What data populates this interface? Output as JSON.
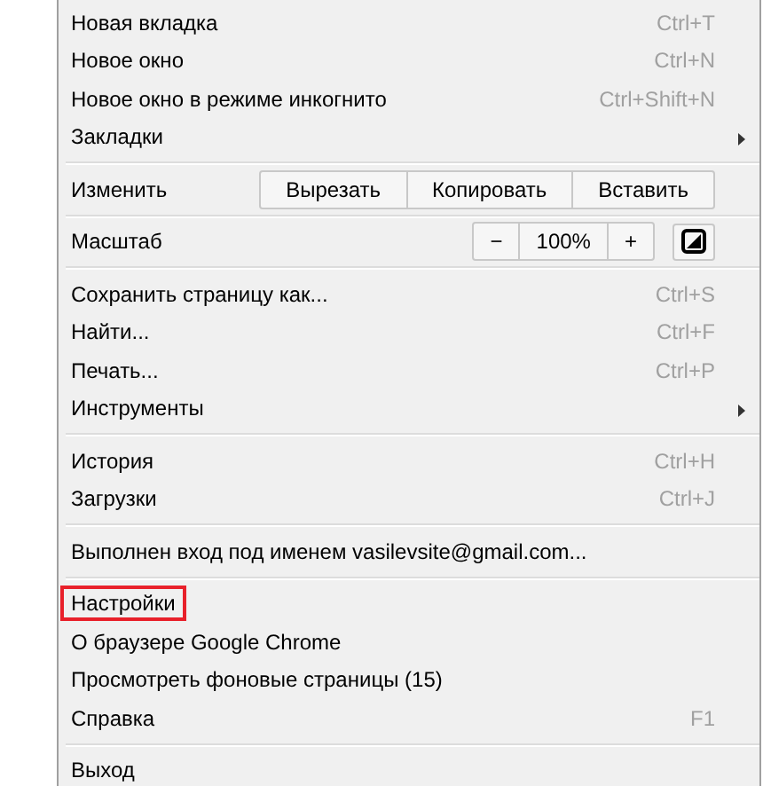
{
  "menu_sections": [
    {
      "items": [
        {
          "kind": "item",
          "label": "Новая вкладка",
          "shortcut": "Ctrl+T"
        },
        {
          "kind": "item",
          "label": "Новое окно",
          "shortcut": "Ctrl+N"
        },
        {
          "kind": "item",
          "label": "Новое окно в режиме инкогнито",
          "shortcut": "Ctrl+Shift+N"
        },
        {
          "kind": "submenu",
          "label": "Закладки"
        }
      ]
    },
    {
      "items": [
        {
          "kind": "edit",
          "label": "Изменить",
          "buttons": [
            "Вырезать",
            "Копировать",
            "Вставить"
          ]
        }
      ]
    },
    {
      "items": [
        {
          "kind": "zoom",
          "label": "Масштаб",
          "minus": "−",
          "value": "100%",
          "plus": "+"
        }
      ]
    },
    {
      "items": [
        {
          "kind": "item",
          "label": "Сохранить страницу как...",
          "shortcut": "Ctrl+S"
        },
        {
          "kind": "item",
          "label": "Найти...",
          "shortcut": "Ctrl+F"
        },
        {
          "kind": "item",
          "label": "Печать...",
          "shortcut": "Ctrl+P"
        },
        {
          "kind": "submenu",
          "label": "Инструменты"
        }
      ]
    },
    {
      "items": [
        {
          "kind": "item",
          "label": "История",
          "shortcut": "Ctrl+H"
        },
        {
          "kind": "item",
          "label": "Загрузки",
          "shortcut": "Ctrl+J"
        }
      ]
    },
    {
      "items": [
        {
          "kind": "item",
          "label": "Выполнен вход под именем vasilevsite@gmail.com..."
        }
      ]
    },
    {
      "items": [
        {
          "kind": "item",
          "label": "Настройки",
          "outlined": true
        },
        {
          "kind": "item",
          "label": "О браузере Google Chrome"
        },
        {
          "kind": "item",
          "label": "Просмотреть фоновые страницы (15)"
        },
        {
          "kind": "item",
          "label": "Справка",
          "shortcut": "F1"
        }
      ]
    },
    {
      "items": [
        {
          "kind": "item",
          "label": "Выход"
        }
      ]
    }
  ]
}
